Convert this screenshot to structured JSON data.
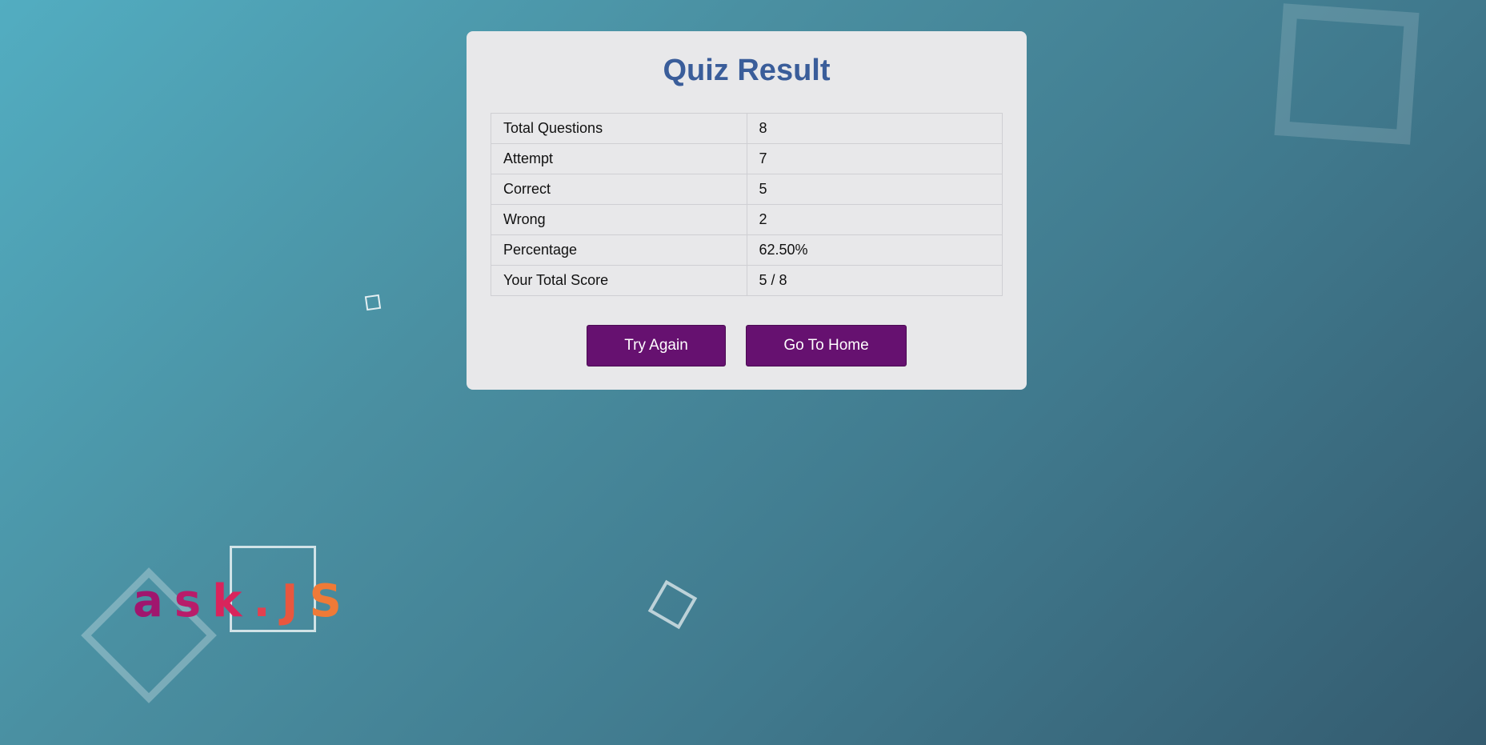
{
  "logo": {
    "letters": [
      "a",
      "s",
      "k",
      ".",
      "J",
      "S"
    ]
  },
  "card": {
    "title": "Quiz Result",
    "rows": [
      {
        "label": "Total Questions",
        "value": "8"
      },
      {
        "label": "Attempt",
        "value": "7"
      },
      {
        "label": "Correct",
        "value": "5"
      },
      {
        "label": "Wrong",
        "value": "2"
      },
      {
        "label": "Percentage",
        "value": "62.50%"
      },
      {
        "label": "Your Total Score",
        "value": "5 / 8"
      }
    ],
    "buttons": {
      "try_again": "Try Again",
      "go_home": "Go To Home"
    }
  },
  "colors": {
    "title": "#3a5d9a",
    "button": "#661170",
    "card_bg": "#e8e8ea"
  }
}
